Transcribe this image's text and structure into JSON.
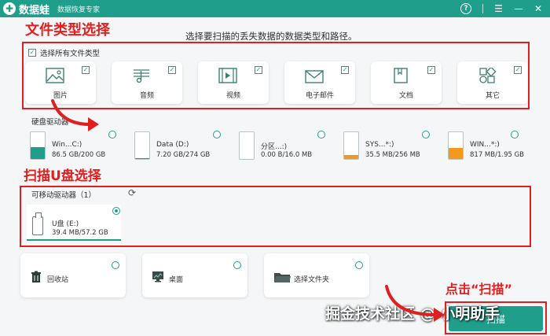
{
  "titlebar": {
    "logo_glyph": "✚",
    "app_name": "数据蛙",
    "subtitle": "数据恢复专家",
    "icons": [
      "help-icon",
      "menu-icon",
      "minimize-icon",
      "close-icon"
    ]
  },
  "instruction": "选择要扫描的丢失数据的数据类型和路径。",
  "annotations": {
    "file_type": "文件类型选择",
    "usb": "扫描U盘选择",
    "click_scan": "点击“扫描”"
  },
  "file_types": {
    "select_all_label": "选择所有文件类型",
    "items": [
      {
        "label": "图片",
        "icon": "image-icon",
        "checked": true
      },
      {
        "label": "音频",
        "icon": "music-icon",
        "checked": true
      },
      {
        "label": "视频",
        "icon": "video-icon",
        "checked": true
      },
      {
        "label": "电子邮件",
        "icon": "email-icon",
        "checked": true
      },
      {
        "label": "文档",
        "icon": "document-icon",
        "checked": true
      },
      {
        "label": "其它",
        "icon": "other-icon",
        "checked": true
      }
    ]
  },
  "hard_drives": {
    "section_label": "硬盘驱动器",
    "items": [
      {
        "name": "Win...C:)",
        "size": "86.5 GB/200 GB",
        "used_fraction": 0.43,
        "fill_color": "#1e9e8b"
      },
      {
        "name": "Data (D:)",
        "size": "7.20 GB/274 GB",
        "used_fraction": 0.03,
        "fill_color": "#1e9e8b"
      },
      {
        "name": "分区...:)",
        "size": "0.00  B/16.0 MB",
        "used_fraction": 0.0,
        "fill_color": "#1e9e8b"
      },
      {
        "name": "SYS...*:)",
        "size": "35.5 MB/256 MB",
        "used_fraction": 0.14,
        "fill_color": "#f39a1e"
      },
      {
        "name": "WIN...*:)",
        "size": "817 MB/1.95 GB",
        "used_fraction": 0.42,
        "fill_color": "#f39a1e"
      }
    ]
  },
  "removable": {
    "section_label": "可移动驱动器（1）",
    "items": [
      {
        "name": "U盘 (E:)",
        "size": "39.4 MB/57.2 GB",
        "selected": true
      }
    ]
  },
  "locations": [
    {
      "label": "回收站",
      "icon": "recycle-bin-icon"
    },
    {
      "label": "桌面",
      "icon": "desktop-icon"
    },
    {
      "label": "选择文件夹",
      "icon": "folder-icon"
    }
  ],
  "scan_button": "扫描",
  "watermark": "掘金技术社区 @ 小明助手",
  "colors": {
    "accent": "#1e9e8b",
    "annotation": "#e02020",
    "warning": "#f39a1e"
  }
}
